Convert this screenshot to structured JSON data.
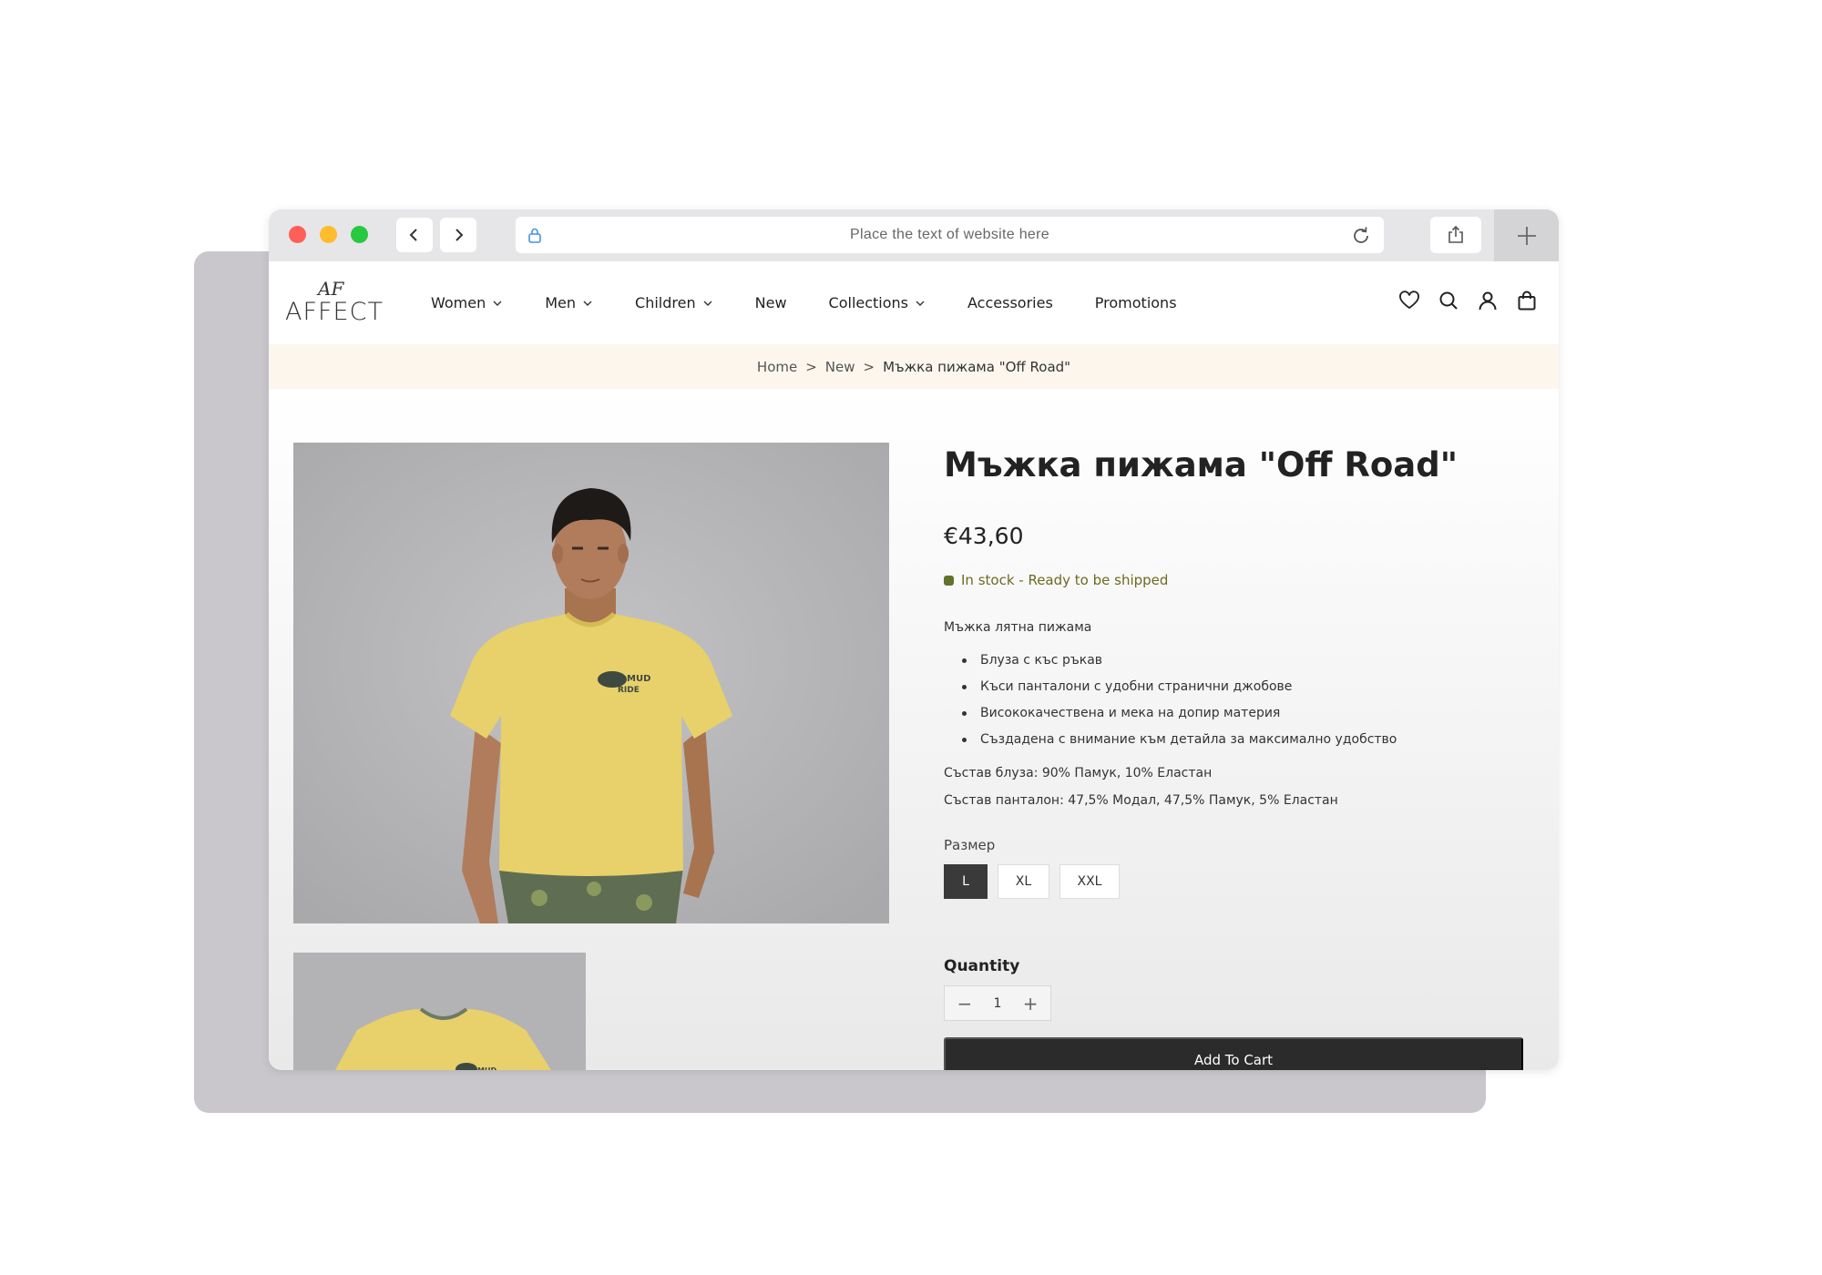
{
  "browser": {
    "url_placeholder": "Place the text of website here",
    "icons": [
      "back-icon",
      "forward-icon",
      "lock-icon",
      "reload-icon",
      "share-icon",
      "plus-icon"
    ]
  },
  "site": {
    "logo_monogram": "AF",
    "logo_text": "AFFECT",
    "nav": [
      {
        "label": "Women",
        "dropdown": true
      },
      {
        "label": "Men",
        "dropdown": true
      },
      {
        "label": "Children",
        "dropdown": true
      },
      {
        "label": "New",
        "dropdown": false
      },
      {
        "label": "Collections",
        "dropdown": true
      },
      {
        "label": "Accessories",
        "dropdown": false
      },
      {
        "label": "Promotions",
        "dropdown": false
      }
    ],
    "header_icons": [
      "heart-icon",
      "search-icon",
      "account-icon",
      "bag-icon"
    ]
  },
  "breadcrumb": {
    "home": "Home",
    "sep": ">",
    "category": "New",
    "current": "Мъжка пижама \"Off Road\""
  },
  "product": {
    "title": "Мъжка пижама \"Off Road\"",
    "price": "€43,60",
    "stock": "In stock - Ready to be shipped",
    "stock_color": "#62722a",
    "description": "Мъжка лятна пижама",
    "bullets": [
      "Блуза с къс ръкав",
      "Къси панталони с удобни странични джобове",
      "Висококачествена и мека на допир материя",
      "Създадена с внимание към детайла за максимално удобство"
    ],
    "composition_top": "Състав блуза: 90% Памук, 10% Еластан",
    "composition_bottom": "Състав панталон: 47,5% Модал, 47,5% Памук, 5% Еластан",
    "size_label": "Размер",
    "sizes": [
      "L",
      "XL",
      "XXL"
    ],
    "selected_size": "L",
    "quantity_label": "Quantity",
    "quantity": "1",
    "qty_minus": "−",
    "qty_plus": "+",
    "add_to_cart": "Add To Cart"
  },
  "colors": {
    "breadcrumb_bg": "#fcf6ed",
    "shirt": "#e8d06a",
    "button_dark": "#2b2b2b"
  }
}
